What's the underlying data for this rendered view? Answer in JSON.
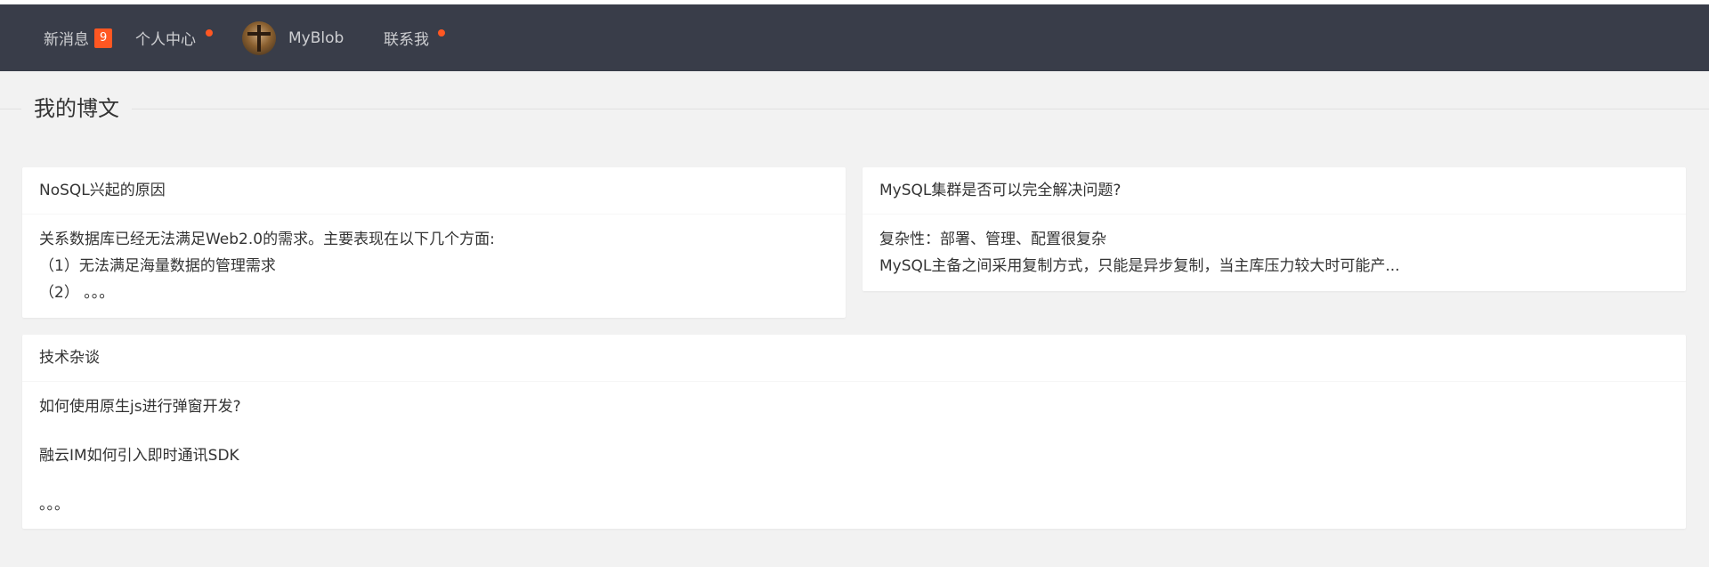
{
  "nav": {
    "messages_label": "新消息",
    "messages_count": "9",
    "personal_label": "个人中心",
    "blob_label": "MyBlob",
    "contact_label": "联系我",
    "dot_color": "#ff5722",
    "bg_color": "#393d49"
  },
  "section": {
    "title": "我的博文"
  },
  "cards": [
    {
      "title": "NoSQL兴起的原因",
      "lines": [
        "关系数据库已经无法满足Web2.0的需求。主要表现在以下几个方面:",
        "（1）无法满足海量数据的管理需求",
        "（2） 。。。"
      ]
    },
    {
      "title": "MySQL集群是否可以完全解决问题?",
      "lines": [
        "复杂性：部署、管理、配置很复杂",
        "MySQL主备之间采用复制方式，只能是异步复制，当主库压力较大时可能产..."
      ]
    },
    {
      "title": "技术杂谈",
      "lines": [
        "如何使用原生js进行弹窗开发?",
        "融云IM如何引入即时通讯SDK",
        "。。。"
      ]
    }
  ]
}
